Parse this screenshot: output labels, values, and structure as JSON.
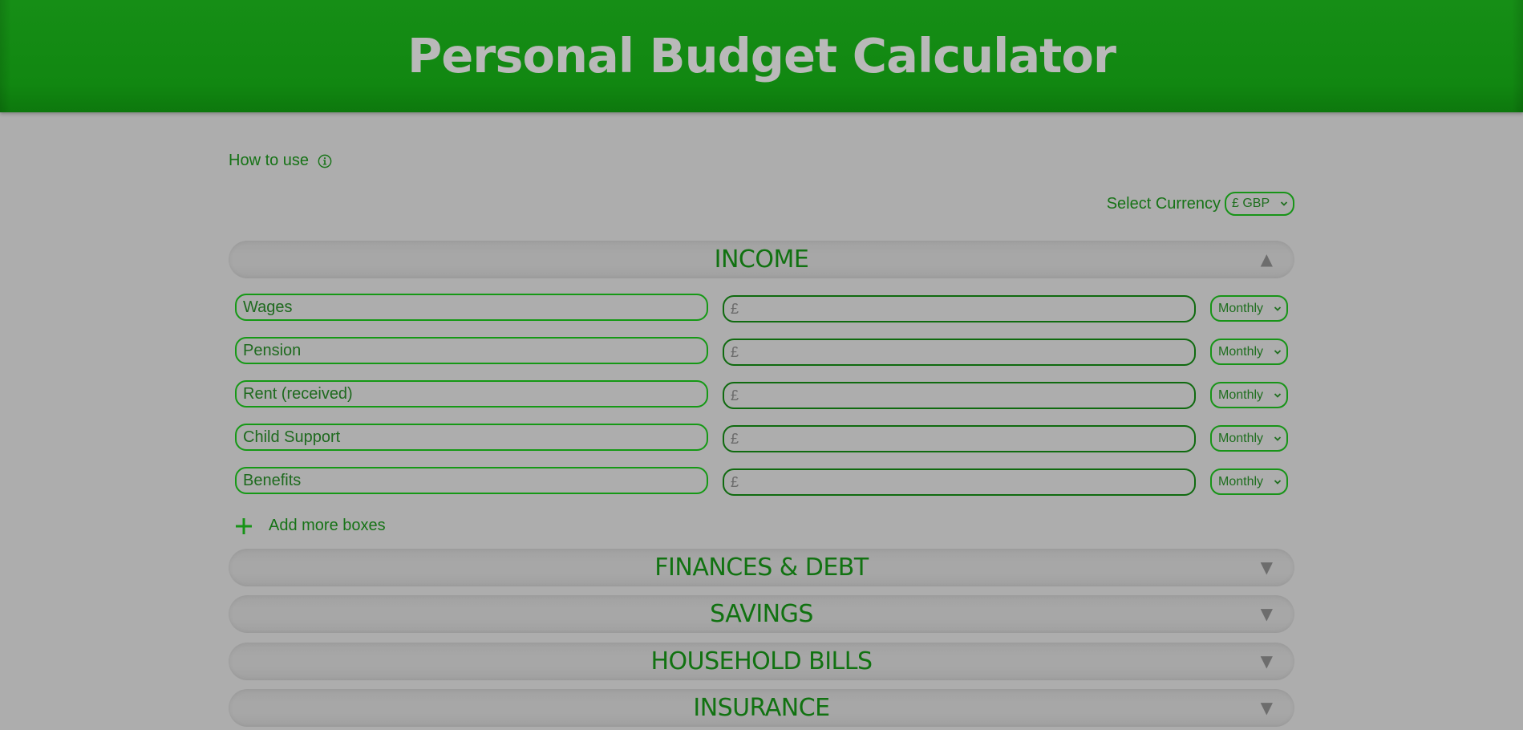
{
  "header": {
    "title": "Personal Budget Calculator"
  },
  "help": {
    "label": "How to use",
    "icon": "info-circle-icon"
  },
  "currency": {
    "label": "Select Currency",
    "selected": "£ GBP"
  },
  "income": {
    "title": "INCOME",
    "arrow": "▲",
    "rows": [
      {
        "label": "Wages",
        "currency_symbol": "£",
        "frequency": "Monthly"
      },
      {
        "label": "Pension",
        "currency_symbol": "£",
        "frequency": "Monthly"
      },
      {
        "label": "Rent (received)",
        "currency_symbol": "£",
        "frequency": "Monthly"
      },
      {
        "label": "Child Support",
        "currency_symbol": "£",
        "frequency": "Monthly"
      },
      {
        "label": "Benefits",
        "currency_symbol": "£",
        "frequency": "Monthly"
      }
    ],
    "add_more": "Add more boxes"
  },
  "sections": [
    {
      "title": "FINANCES & DEBT",
      "arrow": "▼"
    },
    {
      "title": "SAVINGS",
      "arrow": "▼"
    },
    {
      "title": "HOUSEHOLD BILLS",
      "arrow": "▼"
    },
    {
      "title": "INSURANCE",
      "arrow": "▼"
    }
  ],
  "colors": {
    "header_green": "#168e16",
    "accent_green": "#179417",
    "text_green": "#167316",
    "background": "#adadad"
  }
}
